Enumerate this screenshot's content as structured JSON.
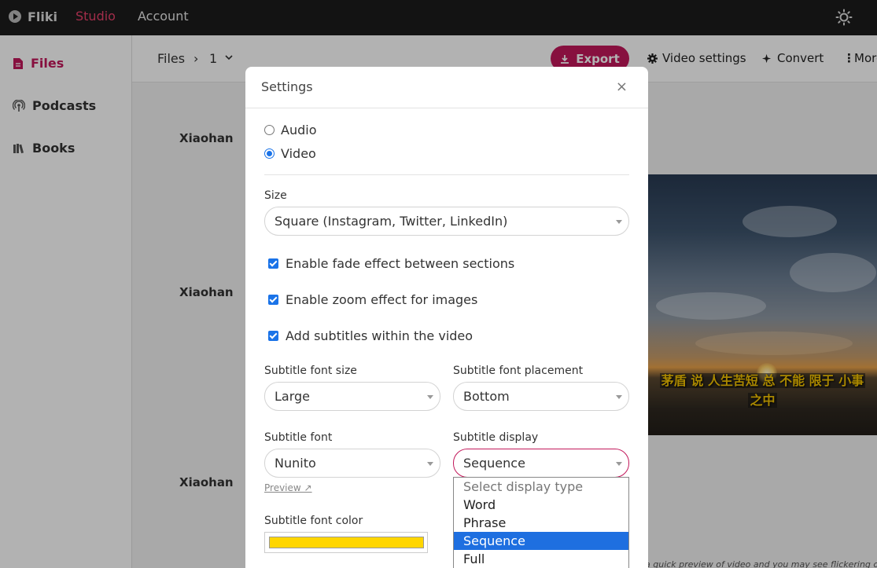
{
  "nav": {
    "logo_text": "Fliki",
    "links": [
      "Studio",
      "Account"
    ],
    "active": "Studio"
  },
  "sidebar": {
    "items": [
      {
        "label": "Files",
        "icon": "file-icon",
        "active": true
      },
      {
        "label": "Podcasts",
        "icon": "podcast-icon",
        "active": false
      },
      {
        "label": "Books",
        "icon": "books-icon",
        "active": false
      }
    ]
  },
  "toolbar": {
    "breadcrumb_root": "Files",
    "breadcrumb_separator": "›",
    "breadcrumb_current": "1",
    "export_label": "Export",
    "video_settings_label": "Video settings",
    "convert_label": "Convert",
    "more_label": "More"
  },
  "content": {
    "authors": [
      "Xiaohan",
      "Xiaohan",
      "Xiaohan"
    ],
    "video_caption_line1": "茅盾 说 人生苦短 总 不能 限于 小事",
    "video_caption_line2": "之中",
    "footer_note": "a quick preview of video and you may see flickering or"
  },
  "modal": {
    "title": "Settings",
    "close": "×",
    "output_options": [
      {
        "label": "Audio",
        "checked": false
      },
      {
        "label": "Video",
        "checked": true
      }
    ],
    "size_label": "Size",
    "size_value": "Square (Instagram, Twitter, LinkedIn)",
    "checkboxes": [
      {
        "label": "Enable fade effect between sections",
        "checked": true
      },
      {
        "label": "Enable zoom effect for images",
        "checked": true
      },
      {
        "label": "Add subtitles within the video",
        "checked": true
      }
    ],
    "subtitle_font_size_label": "Subtitle font size",
    "subtitle_font_size_value": "Large",
    "subtitle_placement_label": "Subtitle font placement",
    "subtitle_placement_value": "Bottom",
    "subtitle_font_label": "Subtitle font",
    "subtitle_font_value": "Nunito",
    "preview_link": "Preview ↗",
    "subtitle_display_label": "Subtitle display",
    "subtitle_display_value": "Sequence",
    "subtitle_color_label": "Subtitle font color",
    "subtitle_color": "#FFD600"
  },
  "display_dropdown": {
    "options": [
      "Select display type",
      "Word",
      "Phrase",
      "Sequence",
      "Full"
    ],
    "selected": "Sequence"
  },
  "colors": {
    "brand": "#C2185B",
    "nav_background": "#1C1C1C",
    "selection": "#1E6FE0"
  }
}
